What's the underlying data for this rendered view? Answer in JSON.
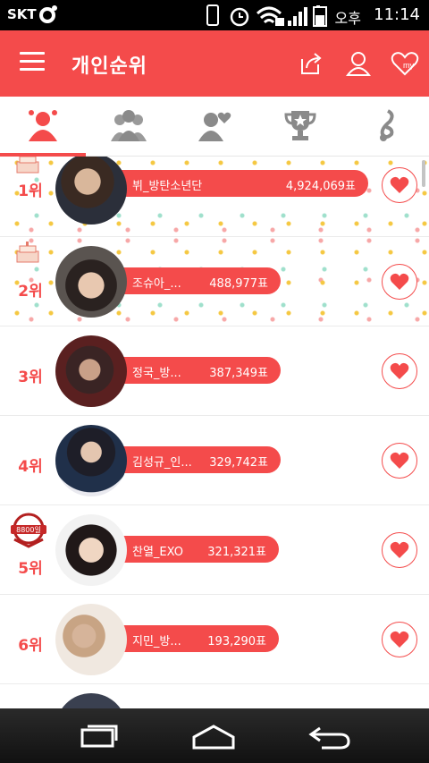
{
  "status_bar": {
    "carrier": "SKT",
    "ampm": "오후",
    "time": "11:14"
  },
  "header": {
    "title": "개인순위"
  },
  "tabs": [
    {
      "icon": "person-icon",
      "active": true
    },
    {
      "icon": "group-icon",
      "active": false
    },
    {
      "icon": "person-heart-icon",
      "active": false
    },
    {
      "icon": "trophy-icon",
      "active": false
    },
    {
      "icon": "music-note-icon",
      "active": false
    }
  ],
  "rankings": [
    {
      "rank": "1위",
      "name": "뷔_방탄소년단",
      "votes": "4,924,069표"
    },
    {
      "rank": "2위",
      "name": "조슈아_...",
      "votes": "488,977표"
    },
    {
      "rank": "3위",
      "name": "정국_방...",
      "votes": "387,349표"
    },
    {
      "rank": "4위",
      "name": "김성규_인...",
      "votes": "329,742표"
    },
    {
      "rank": "5위",
      "name": "찬열_EXO",
      "votes": "321,321표"
    },
    {
      "rank": "6위",
      "name": "지민_방...",
      "votes": "193,290표"
    }
  ],
  "badge": {
    "text": "8800일"
  },
  "colors": {
    "accent": "#f44b4b",
    "nav_bar": "#1a1a1a"
  }
}
